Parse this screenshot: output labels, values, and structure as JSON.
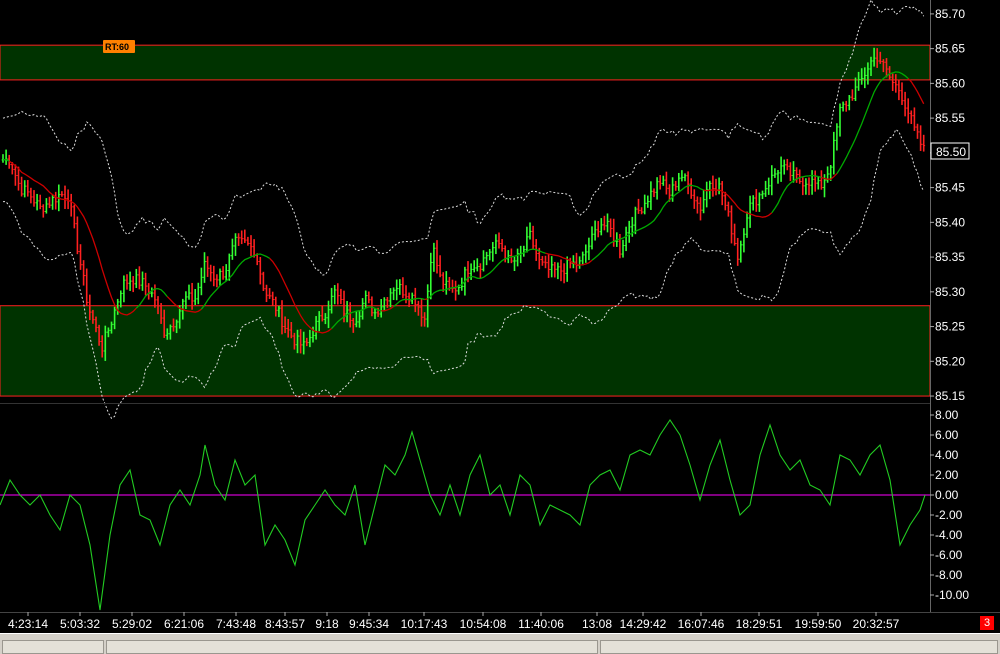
{
  "colors": {
    "background": "#000000",
    "zone_fill": "#003300",
    "zone_edge": "#ff2020",
    "bar_up": "#33ff33",
    "bar_down": "#ff2020",
    "ma_line": "#00aa00",
    "ma_red": "#cc0000",
    "band_line": "#dddddd",
    "osc_line": "#22cc22",
    "zero_line": "#cc00cc",
    "tag_bg": "#ff8000",
    "badge_bg": "#ff0000"
  },
  "chart_data": [
    {
      "type": "candlestick",
      "tag_label": "RT:60",
      "ylim": [
        85.14,
        85.72
      ],
      "y_ticks": [
        "85.70",
        "85.65",
        "85.60",
        "85.55",
        "85.50",
        "85.45",
        "85.40",
        "85.35",
        "85.30",
        "85.25",
        "85.20",
        "85.15"
      ],
      "last_price": "85.50",
      "zones": [
        {
          "from": 85.605,
          "to": 85.655
        },
        {
          "from": 85.15,
          "to": 85.28
        }
      ],
      "x_labels": [
        "4:23:14",
        "5:03:32",
        "5:29:02",
        "6:21:06",
        "7:43:48",
        "8:43:57",
        "9:18",
        "9:45:34",
        "10:17:43",
        "10:54:08",
        "11:40:06",
        "13:08",
        "14:29:42",
        "16:07:46",
        "18:29:51",
        "19:59:50",
        "20:32:57"
      ],
      "close_path": [
        [
          0,
          85.49
        ],
        [
          10,
          85.49
        ],
        [
          20,
          85.45
        ],
        [
          30,
          85.44
        ],
        [
          40,
          85.42
        ],
        [
          50,
          85.43
        ],
        [
          60,
          85.44
        ],
        [
          68,
          85.44
        ],
        [
          78,
          85.36
        ],
        [
          88,
          85.28
        ],
        [
          95,
          85.25
        ],
        [
          102,
          85.22
        ],
        [
          112,
          85.26
        ],
        [
          122,
          85.31
        ],
        [
          132,
          85.32
        ],
        [
          145,
          85.31
        ],
        [
          155,
          85.29
        ],
        [
          165,
          85.24
        ],
        [
          175,
          85.26
        ],
        [
          185,
          85.29
        ],
        [
          195,
          85.29
        ],
        [
          205,
          85.34
        ],
        [
          215,
          85.32
        ],
        [
          225,
          85.33
        ],
        [
          235,
          85.37
        ],
        [
          245,
          85.37
        ],
        [
          255,
          85.36
        ],
        [
          265,
          85.3
        ],
        [
          275,
          85.28
        ],
        [
          285,
          85.25
        ],
        [
          295,
          85.23
        ],
        [
          305,
          85.22
        ],
        [
          315,
          85.25
        ],
        [
          325,
          85.27
        ],
        [
          335,
          85.3
        ],
        [
          345,
          85.27
        ],
        [
          355,
          85.26
        ],
        [
          365,
          85.29
        ],
        [
          375,
          85.27
        ],
        [
          385,
          85.29
        ],
        [
          395,
          85.31
        ],
        [
          405,
          85.3
        ],
        [
          415,
          85.29
        ],
        [
          425,
          85.26
        ],
        [
          432,
          85.37
        ],
        [
          440,
          85.32
        ],
        [
          450,
          85.3
        ],
        [
          460,
          85.31
        ],
        [
          470,
          85.34
        ],
        [
          480,
          85.34
        ],
        [
          490,
          85.36
        ],
        [
          500,
          85.37
        ],
        [
          510,
          85.34
        ],
        [
          520,
          85.35
        ],
        [
          530,
          85.38
        ],
        [
          540,
          85.34
        ],
        [
          550,
          85.33
        ],
        [
          560,
          85.33
        ],
        [
          570,
          85.34
        ],
        [
          580,
          85.34
        ],
        [
          590,
          85.37
        ],
        [
          600,
          85.4
        ],
        [
          610,
          85.39
        ],
        [
          620,
          85.36
        ],
        [
          630,
          85.4
        ],
        [
          640,
          85.42
        ],
        [
          650,
          85.44
        ],
        [
          660,
          85.46
        ],
        [
          670,
          85.44
        ],
        [
          680,
          85.47
        ],
        [
          690,
          85.45
        ],
        [
          700,
          85.42
        ],
        [
          710,
          85.46
        ],
        [
          720,
          85.45
        ],
        [
          730,
          85.4
        ],
        [
          738,
          85.35
        ],
        [
          748,
          85.42
        ],
        [
          760,
          85.44
        ],
        [
          770,
          85.46
        ],
        [
          780,
          85.48
        ],
        [
          790,
          85.47
        ],
        [
          800,
          85.46
        ],
        [
          810,
          85.46
        ],
        [
          820,
          85.45
        ],
        [
          830,
          85.48
        ],
        [
          840,
          85.56
        ],
        [
          850,
          85.58
        ],
        [
          860,
          85.6
        ],
        [
          870,
          85.63
        ],
        [
          878,
          85.64
        ],
        [
          885,
          85.62
        ],
        [
          893,
          85.6
        ],
        [
          900,
          85.59
        ],
        [
          908,
          85.56
        ],
        [
          915,
          85.53
        ],
        [
          925,
          85.5
        ]
      ]
    },
    {
      "type": "line",
      "ylim": [
        -11.5,
        8.5
      ],
      "y_ticks": [
        "8.00",
        "6.00",
        "4.00",
        "2.00",
        "0.00",
        "-2.00",
        "-4.00",
        "-6.00",
        "-8.00",
        "-10.00"
      ],
      "zero_value": 0,
      "x": [
        0,
        10,
        20,
        30,
        40,
        50,
        60,
        70,
        80,
        90,
        100,
        110,
        120,
        130,
        140,
        150,
        160,
        170,
        180,
        190,
        200,
        205,
        215,
        225,
        235,
        245,
        255,
        265,
        275,
        285,
        295,
        305,
        315,
        325,
        335,
        345,
        355,
        365,
        375,
        385,
        395,
        405,
        412,
        420,
        430,
        440,
        450,
        460,
        470,
        480,
        490,
        500,
        510,
        520,
        530,
        540,
        550,
        560,
        570,
        580,
        590,
        600,
        610,
        620,
        630,
        640,
        650,
        660,
        670,
        680,
        690,
        700,
        710,
        720,
        730,
        740,
        750,
        760,
        770,
        780,
        790,
        800,
        810,
        820,
        830,
        840,
        850,
        860,
        870,
        880,
        890,
        900,
        910,
        920,
        925
      ],
      "values": [
        -1,
        1.5,
        0,
        -1,
        0,
        -2,
        -3.5,
        0,
        -1,
        -5,
        -11.5,
        -4,
        1,
        2.5,
        -2,
        -2.5,
        -5,
        -1,
        0.5,
        -1,
        2,
        5,
        1,
        -0.5,
        3.5,
        1,
        2,
        -5,
        -3,
        -4.5,
        -7,
        -2.5,
        -1,
        0.5,
        -1,
        -2,
        1,
        -5,
        -1,
        3,
        2,
        4,
        6.3,
        3.5,
        0,
        -2,
        1,
        -2,
        2,
        4,
        0,
        1,
        -2,
        2,
        1,
        -3,
        -1,
        -1.5,
        -2,
        -3,
        1,
        2,
        2.5,
        0.5,
        4,
        4.5,
        4,
        6,
        7.5,
        6,
        3,
        -0.5,
        3,
        5.5,
        1.5,
        -2,
        -1,
        4,
        7,
        4,
        2.5,
        3.5,
        1,
        0.5,
        -1,
        4,
        3.5,
        2,
        4,
        5,
        1.5,
        -5,
        -3,
        -1.5,
        0
      ]
    }
  ]
}
